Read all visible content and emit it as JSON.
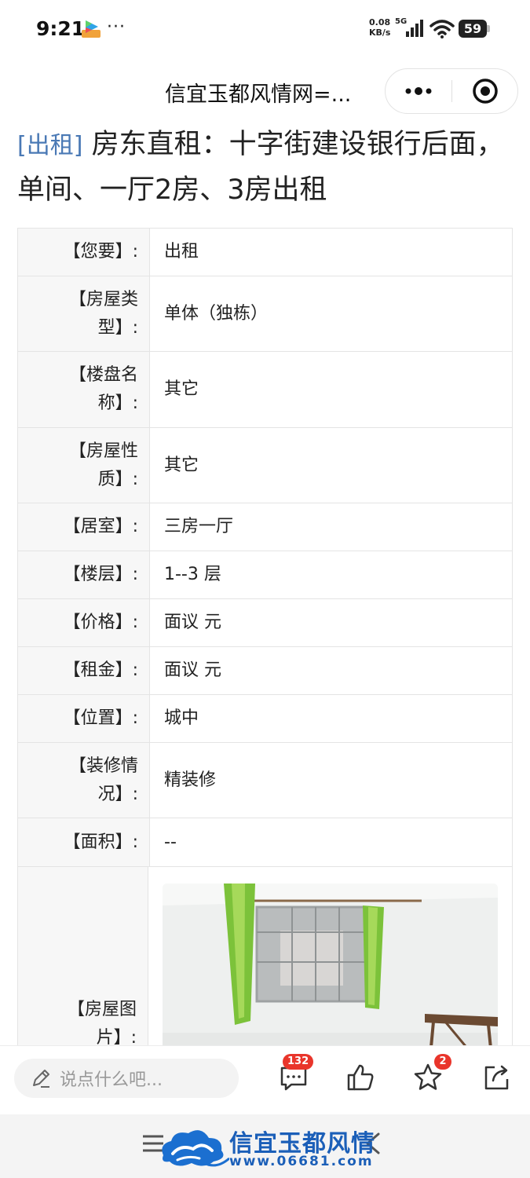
{
  "status": {
    "time": "9:21",
    "net_speed_value": "0.08",
    "net_speed_unit": "KB/s",
    "network": "5G",
    "battery": "59"
  },
  "nav": {
    "title": "信宜玉都风情网=..."
  },
  "post": {
    "tag": "[出租]",
    "title": "房东直租：十字街建设银行后面，单间、一厅2房、3房出租"
  },
  "details": [
    {
      "label": "【您要】:",
      "value": "出租"
    },
    {
      "label": "【房屋类型】:",
      "value": "单体（独栋）"
    },
    {
      "label": "【楼盘名称】:",
      "value": "其它"
    },
    {
      "label": "【房屋性质】:",
      "value": "其它"
    },
    {
      "label": "【居室】:",
      "value": "三房一厅"
    },
    {
      "label": "【楼层】:",
      "value": "1--3 层"
    },
    {
      "label": "【价格】:",
      "value": "面议 元"
    },
    {
      "label": "【租金】:",
      "value": "面议 元"
    },
    {
      "label": "【位置】:",
      "value": "城中"
    },
    {
      "label": "【装修情况】:",
      "value": "精装修"
    },
    {
      "label": "【面积】:",
      "value": "--"
    },
    {
      "label": "【房屋图片】:",
      "value": ""
    }
  ],
  "actions": {
    "comment_placeholder": "说点什么吧...",
    "comment_count": "132",
    "favorite_count": "2"
  },
  "footer": {
    "logo_title": "信宜玉都风情",
    "logo_url": "www.06681.com"
  },
  "colors": {
    "tag": "#4a79b5",
    "badge": "#e9352b",
    "logo": "#1b5fb8"
  }
}
